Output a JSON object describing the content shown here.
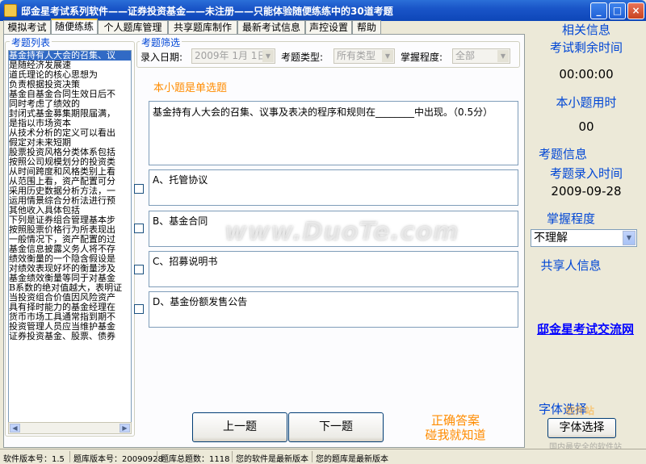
{
  "window": {
    "title": "邸金星考试系列软件——证券投资基金——未注册——只能体验随便练练中的30道考题",
    "minimize": "_",
    "maximize": "□",
    "close": "×"
  },
  "tabs": [
    {
      "label": "模拟考试"
    },
    {
      "label": "随便练练"
    },
    {
      "label": "个人题库管理"
    },
    {
      "label": "共享题库制作"
    },
    {
      "label": "最新考试信息"
    },
    {
      "label": "声控设置"
    },
    {
      "label": "帮助"
    }
  ],
  "question_list": {
    "title": "考题列表",
    "items": [
      "基金持有人大会的召集、议",
      "            是随经济发展速",
      "道氏理论的核心思想为",
      "       负责根据投资决策",
      "基金自基金合同生效日后不",
      "        同时考虑了绩效的",
      "封闭式基金募集期限届满，",
      "          是指以市场资本",
      "从技术分析的定义可以看出",
      "            假定对未来短期",
      "股票投资风格分类体系包括",
      "按照公司规模划分的投资类",
      "从时间跨度和风格类别上看",
      "从范围上看，资产配置可分",
      "采用历史数据分析方法，一",
      "运用情景综合分析法进行预",
      "其他收入具体包括",
      "下列是证券组合管理基本步",
      "按照股票价格行为所表现出",
      "一般情况下，资产配置的过",
      "基金信息披露义务人将不存",
      "绩效衡量的一个隐含假设是",
      "对绩效表现好坏的衡量涉及",
      "基金绩效衡量等同于对基金",
      "B系数的绝对值越大，表明证",
      "当投资组合价值因风险资产",
      "具有择时能力的基金经理在",
      "货币市场工具通常指到期不",
      "投资管理人员应当维护基金",
      "证券投资基金、股票、债券"
    ],
    "scroll_left": "◀",
    "scroll_right": "▶"
  },
  "filter": {
    "title": "考题筛选",
    "date_label": "录入日期:",
    "date_value": "2009年 1月 1日",
    "type_label": "考题类型:",
    "type_value": "所有类型",
    "mastery_label": "掌握程度:",
    "mastery_value": "全部",
    "dropdown": "▼"
  },
  "question": {
    "type_notice": "本小题是单选题",
    "text": "基金持有人大会的召集、议事及表决的程序和规则在________中出现。（0.5分）",
    "options": [
      {
        "text": "A、托管协议"
      },
      {
        "text": "B、基金合同"
      },
      {
        "text": "C、招募说明书"
      },
      {
        "text": "D、基金份额发售公告"
      }
    ]
  },
  "nav": {
    "prev": "上一题",
    "next": "下一题",
    "answer_line1": "正确答案",
    "answer_line2": "碰我就知道"
  },
  "side": {
    "related_info": "相关信息",
    "time_left_label": "考试剩余时间",
    "time_left_value": "00:00:00",
    "time_used_label": "本小题用时",
    "time_used_value": "00",
    "question_info": "考题信息",
    "entry_time_label": "考题录入时间",
    "entry_time_value": "2009-09-28",
    "mastery_label": "掌握程度",
    "mastery_value": "不理解",
    "sharer_label": "共享人信息",
    "sharer_link": "邸金星考试交流网",
    "font_label": "字体选择",
    "font_button": "字体选择",
    "dropdown": "▼"
  },
  "status": {
    "version": "软件版本号：1.5",
    "db_version": "题库版本号：20090928",
    "db_total": "题库总题数：1118",
    "sw_status": "您的软件是最新版本",
    "db_status": "您的题库是最新版本"
  },
  "watermark": {
    "main": "www.DuoTe.com",
    "corner1": "软件站",
    "corner2": "国内最安全的软件站"
  }
}
